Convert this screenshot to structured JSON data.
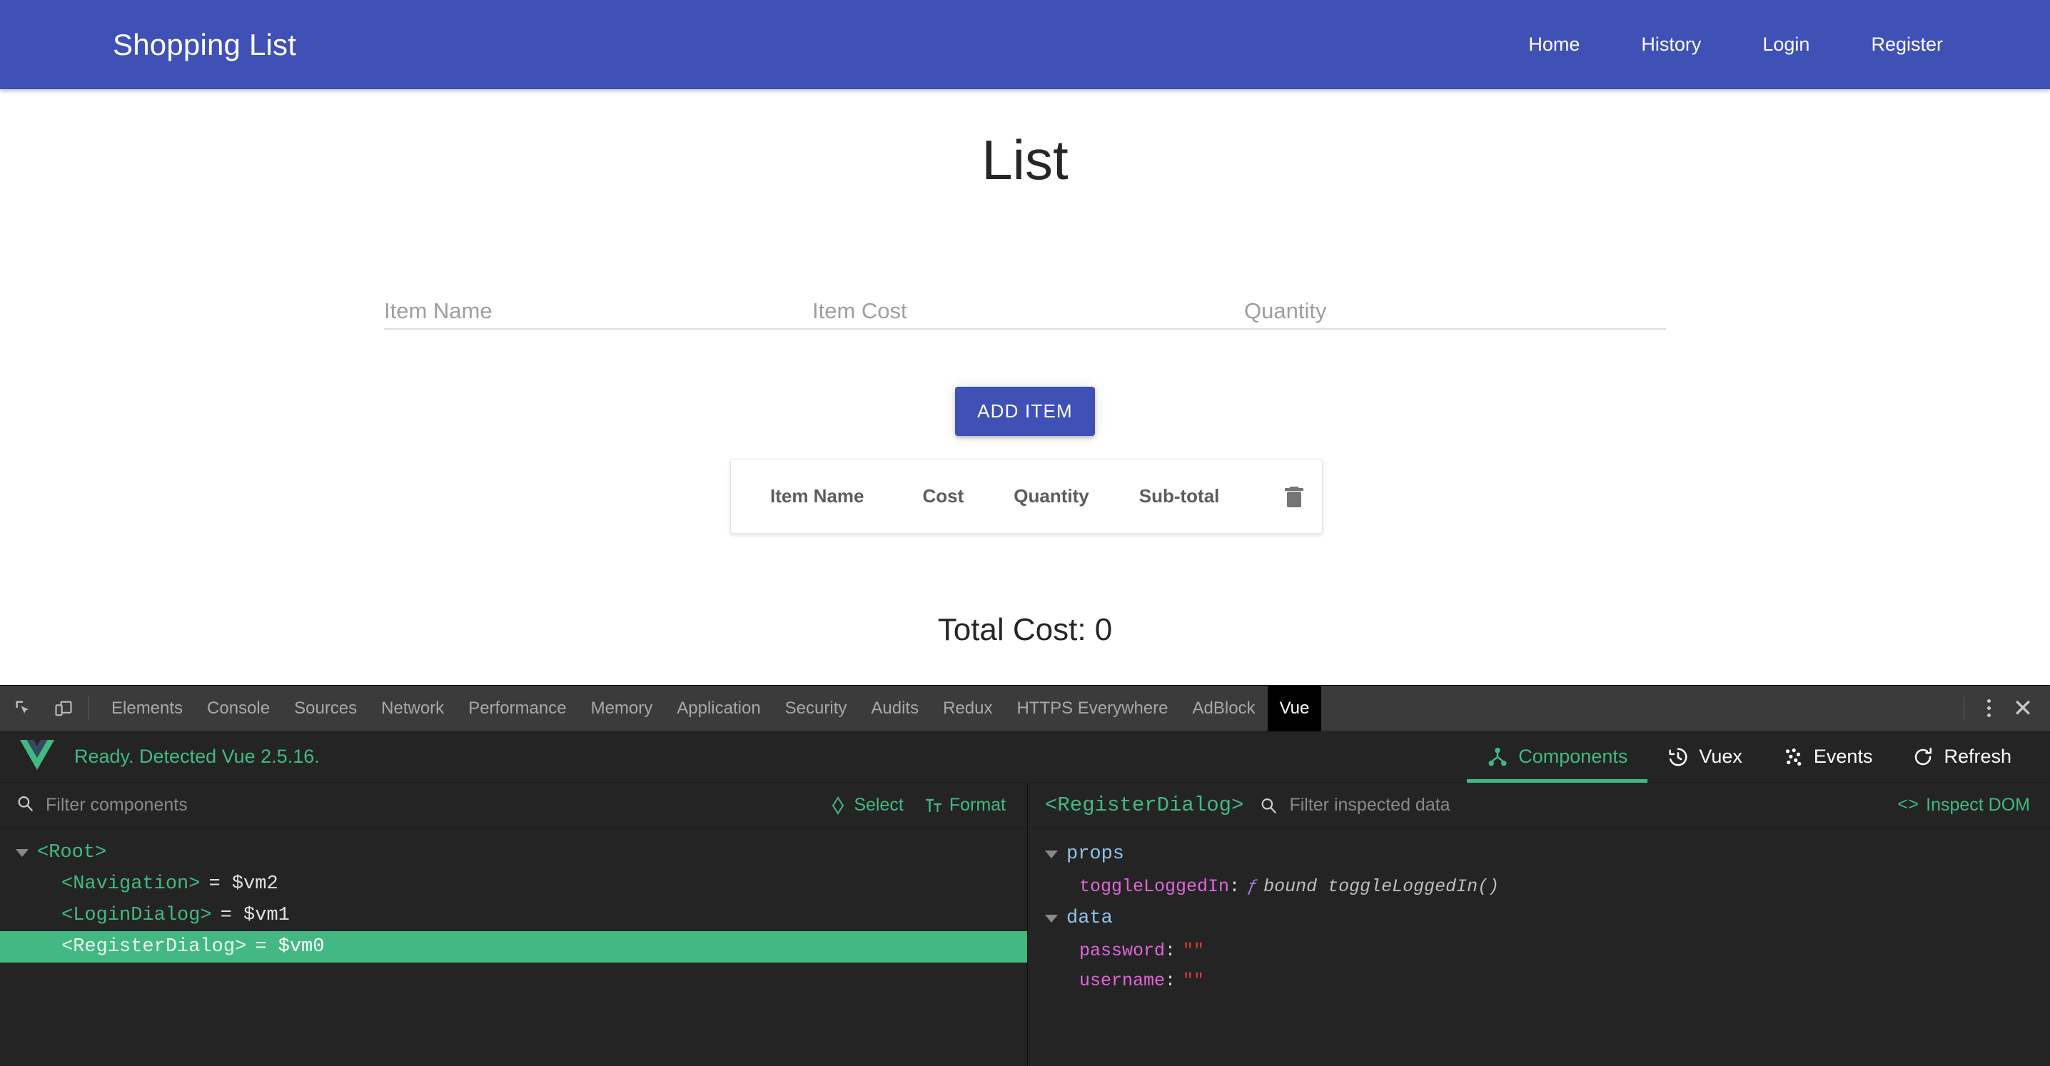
{
  "app": {
    "brand": "Shopping List",
    "nav_links": [
      {
        "label": "Home",
        "name": "nav-link-home"
      },
      {
        "label": "History",
        "name": "nav-link-history"
      },
      {
        "label": "Login",
        "name": "nav-link-login"
      },
      {
        "label": "Register",
        "name": "nav-link-register"
      }
    ],
    "page_title": "List",
    "form": {
      "item_name_placeholder": "Item Name",
      "item_name_value": "",
      "item_cost_placeholder": "Item Cost",
      "item_cost_value": "",
      "quantity_placeholder": "Quantity",
      "quantity_value": "",
      "add_button_label": "ADD ITEM"
    },
    "table": {
      "headers": [
        "Item Name",
        "Cost",
        "Quantity",
        "Sub-total"
      ],
      "delete_icon": "trash-icon",
      "rows": []
    },
    "total_cost_label": "Total Cost: 0",
    "colors": {
      "primary": "#3f51b5",
      "text": "#262626",
      "placeholder": "#9e9e9e"
    }
  },
  "devtools": {
    "left_icons": [
      "inspect-element-icon",
      "device-toolbar-icon"
    ],
    "tabs": [
      {
        "label": "Elements",
        "active": false
      },
      {
        "label": "Console",
        "active": false
      },
      {
        "label": "Sources",
        "active": false
      },
      {
        "label": "Network",
        "active": false
      },
      {
        "label": "Performance",
        "active": false
      },
      {
        "label": "Memory",
        "active": false
      },
      {
        "label": "Application",
        "active": false
      },
      {
        "label": "Security",
        "active": false
      },
      {
        "label": "Audits",
        "active": false
      },
      {
        "label": "Redux",
        "active": false
      },
      {
        "label": "HTTPS Everywhere",
        "active": false
      },
      {
        "label": "AdBlock",
        "active": false
      },
      {
        "label": "Vue",
        "active": true
      }
    ],
    "more_icon": "kebab-menu-icon",
    "close_label": "✕"
  },
  "vue_panel": {
    "logo": "vue-logo-icon",
    "status": "Ready. Detected Vue 2.5.16.",
    "tabs": [
      {
        "label": "Components",
        "icon": "components-tree-icon",
        "active": true
      },
      {
        "label": "Vuex",
        "icon": "history-clock-icon",
        "active": false
      },
      {
        "label": "Events",
        "icon": "events-dots-icon",
        "active": false
      },
      {
        "label": "Refresh",
        "icon": "refresh-icon",
        "active": false
      }
    ],
    "accent": "#42b983",
    "tree_pane": {
      "filter_placeholder": "Filter components",
      "filter_value": "",
      "select_label": "Select",
      "format_label": "Format",
      "nodes": [
        {
          "tag": "<Root>",
          "vm": "",
          "depth": 0,
          "caret": true,
          "selected": false
        },
        {
          "tag": "<Navigation>",
          "vm": "= $vm2",
          "depth": 1,
          "caret": false,
          "selected": false
        },
        {
          "tag": "<LoginDialog>",
          "vm": "= $vm1",
          "depth": 1,
          "caret": false,
          "selected": false
        },
        {
          "tag": "<RegisterDialog>",
          "vm": "= $vm0",
          "depth": 1,
          "caret": false,
          "selected": true
        }
      ]
    },
    "inspector_pane": {
      "title": "<RegisterDialog>",
      "filter_placeholder": "Filter inspected data",
      "filter_value": "",
      "inspect_dom_label": "Inspect DOM",
      "groups": [
        {
          "name": "props",
          "entries": [
            {
              "key": "toggleLoggedIn",
              "value": "bound toggleLoggedIn()",
              "kind": "function",
              "symbol": "ƒ"
            }
          ]
        },
        {
          "name": "data",
          "entries": [
            {
              "key": "password",
              "value": "\"\"",
              "kind": "string"
            },
            {
              "key": "username",
              "value": "\"\"",
              "kind": "string"
            }
          ]
        }
      ]
    }
  }
}
